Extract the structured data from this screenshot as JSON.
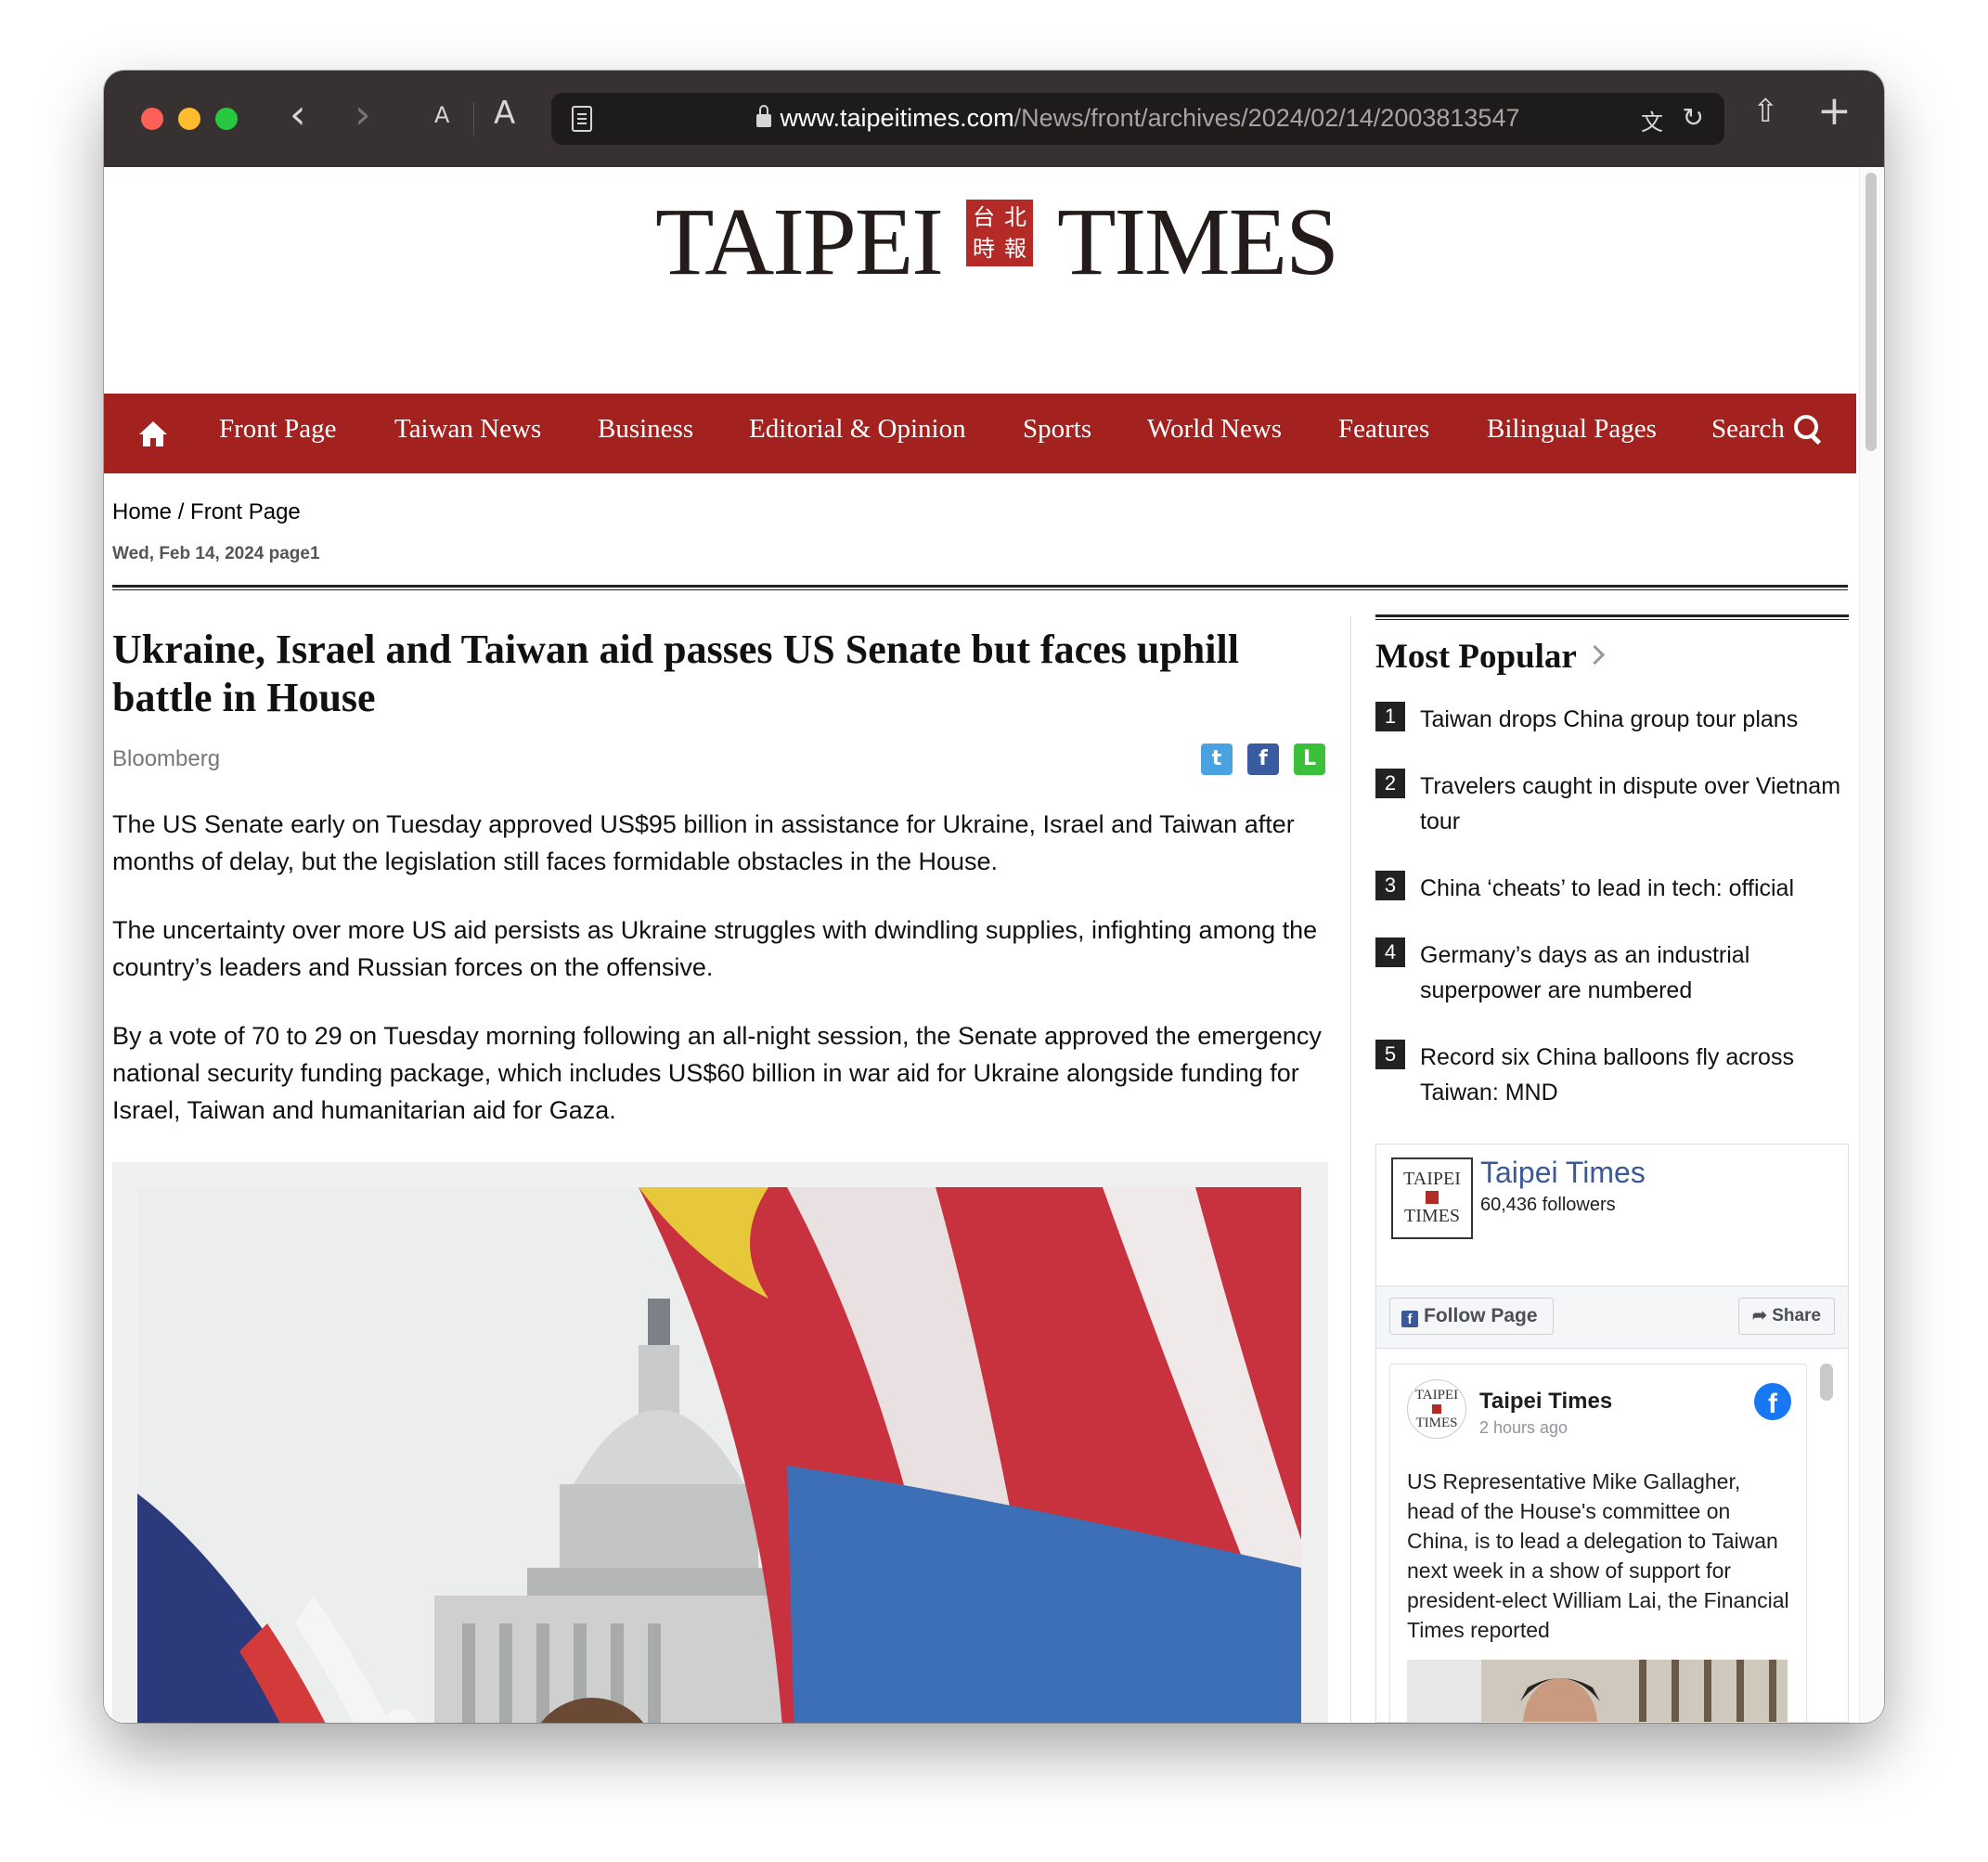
{
  "browser": {
    "url_host": "www.taipeitimes.com",
    "url_path": "/News/front/archives/2024/02/14/2003813547",
    "text_size_small": "A",
    "text_size_large": "A"
  },
  "site": {
    "logo_left": "TAIPEI",
    "logo_right": "TIMES",
    "seal_chars": [
      "台",
      "北",
      "時",
      "報"
    ],
    "accent_color": "#a3211e"
  },
  "nav": {
    "items": [
      "Front Page",
      "Taiwan News",
      "Business",
      "Editorial & Opinion",
      "Sports",
      "World News",
      "Features",
      "Bilingual Pages",
      "Search"
    ]
  },
  "breadcrumb": {
    "home": "Home",
    "separator": "/",
    "current": "Front Page"
  },
  "article": {
    "dateline": "Wed, Feb 14, 2024 page1",
    "headline": "Ukraine, Israel and Taiwan aid passes US Senate but faces uphill battle in House",
    "byline": "Bloomberg",
    "paragraphs": [
      "The US Senate early on Tuesday approved US$95 billion in assistance for Ukraine, Israel and Taiwan after months of delay, but the legislation still faces formidable obstacles in the House.",
      "The uncertainty over more US aid persists as Ukraine struggles with dwindling supplies, infighting among the country’s leaders and Russian forces on the offensive.",
      "By a vote of 70 to 29 on Tuesday morning following an all-night session, the Senate approved the emergency national security funding package, which includes US$60 billion in war aid for Ukraine alongside funding for Israel, Taiwan and humanitarian aid for Gaza."
    ]
  },
  "sidebar": {
    "popular_title": "Most Popular",
    "popular_items": [
      {
        "num": "1",
        "text": "Taiwan drops China group tour plans"
      },
      {
        "num": "2",
        "text": "Travelers caught in dispute over Vietnam tour"
      },
      {
        "num": "3",
        "text": "China ‘cheats’ to lead in tech: official"
      },
      {
        "num": "4",
        "text": "Germany’s days as an industrial superpower are numbered"
      },
      {
        "num": "5",
        "text": "Record six China balloons fly across Taiwan: MND"
      }
    ],
    "facebook": {
      "logo_top": "TAIPEI",
      "logo_bottom": "TIMES",
      "page_name": "Taipei Times",
      "followers": "60,436 followers",
      "follow_label": "Follow Page",
      "share_label": "Share",
      "post_author": "Taipei Times",
      "post_time": "2 hours ago",
      "post_text": "US Representative Mike Gallagher, head of the House's committee on China, is to lead a delegation to Taiwan next week in a show of support for president-elect William Lai, the Financial Times reported"
    }
  }
}
